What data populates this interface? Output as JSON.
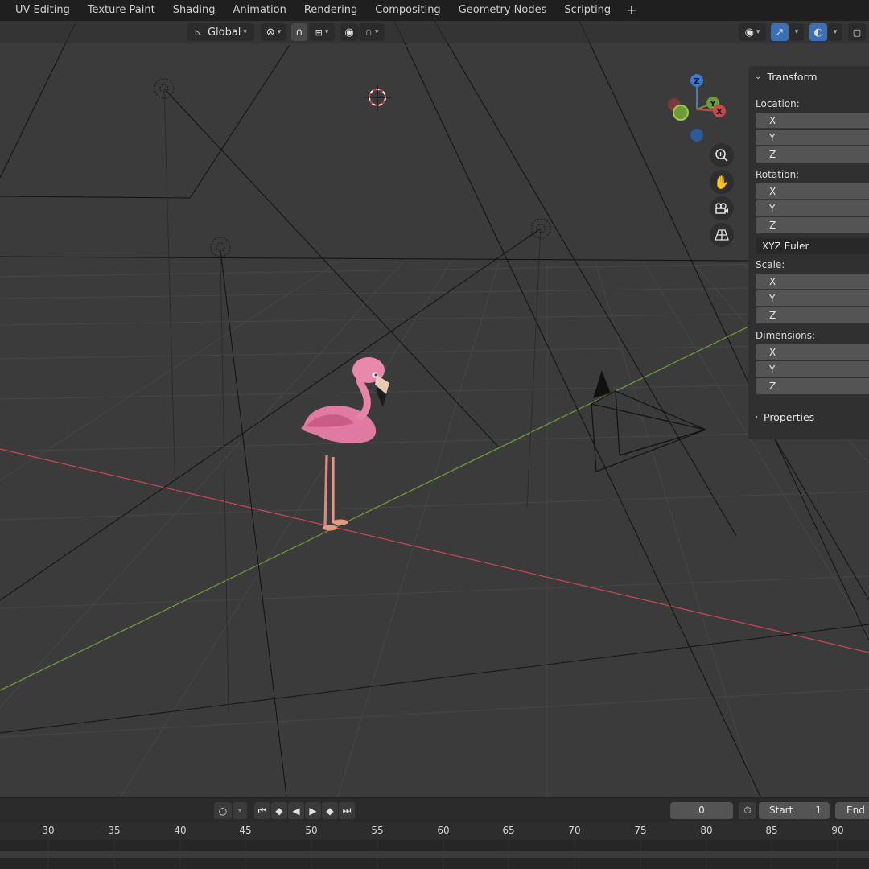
{
  "workspace_tabs": [
    "UV Editing",
    "Texture Paint",
    "Shading",
    "Animation",
    "Rendering",
    "Compositing",
    "Geometry Nodes",
    "Scripting"
  ],
  "workspace_add": "+",
  "header": {
    "orientation": "Global",
    "orientation_icon": "transform-orientation-icon",
    "pivot_icon": "pivot-point-icon",
    "snap_icon": "magnet-snap-icon",
    "proportional_icon": "proportional-editing-icon",
    "visibility_icon": "eye-visibility-icon",
    "gizmo_icon": "gizmo-toggle-icon",
    "overlay_icon": "overlay-icon"
  },
  "npanel": {
    "transform_title": "Transform",
    "location_label": "Location:",
    "rotation_label": "Rotation:",
    "rotation_mode": "XYZ Euler",
    "scale_label": "Scale:",
    "dimensions_label": "Dimensions:",
    "axis_x": "X",
    "axis_y": "Y",
    "axis_z": "Z",
    "properties_title": "Properties"
  },
  "gizmo": {
    "x": "X",
    "y": "Y",
    "z": "Z"
  },
  "nav_icons": [
    "zoom-icon",
    "pan-hand-icon",
    "camera-view-icon",
    "perspective-grid-icon"
  ],
  "timeline": {
    "current_frame": "0",
    "start_label": "Start",
    "start_value": "1",
    "end_label": "End",
    "ruler_ticks": [
      "30",
      "35",
      "40",
      "45",
      "50",
      "55",
      "60",
      "65",
      "70",
      "75",
      "80",
      "85",
      "90"
    ]
  },
  "colors": {
    "x_axis": "#c64a50",
    "y_axis": "#6e9a3a",
    "z_axis": "#3a7bd5",
    "flamingo": "#e77fa3",
    "viewport_bg": "#3b3b3b"
  }
}
